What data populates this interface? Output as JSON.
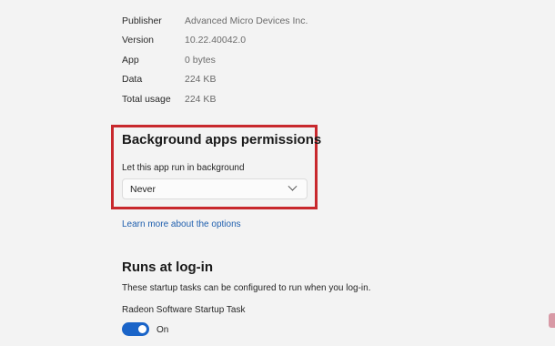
{
  "app_specs": [
    {
      "label": "Publisher",
      "value": "Advanced Micro Devices Inc."
    },
    {
      "label": "Version",
      "value": "10.22.40042.0"
    },
    {
      "label": "App",
      "value": "0 bytes"
    },
    {
      "label": "Data",
      "value": "224 KB"
    },
    {
      "label": "Total usage",
      "value": "224 KB"
    }
  ],
  "background_permissions": {
    "title": "Background apps permissions",
    "setting_label": "Let this app run in background",
    "selected_option": "Never",
    "learn_more_link": "Learn more about the options",
    "highlight_color": "#c8282d"
  },
  "runs_at_login": {
    "title": "Runs at log-in",
    "description": "These startup tasks can be configured to run when you log-in.",
    "task_name": "Radeon Software Startup Task",
    "toggle_state": "On",
    "toggle_on": true,
    "toggle_color": "#1a64c8"
  },
  "icons": {
    "dropdown": "chevron-down-icon"
  }
}
